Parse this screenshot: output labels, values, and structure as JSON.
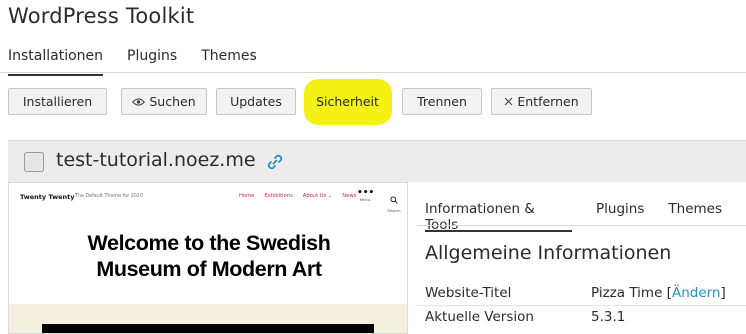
{
  "app": {
    "title": "WordPress Toolkit"
  },
  "main_tabs": [
    {
      "label": "Installationen",
      "active": true
    },
    {
      "label": "Plugins",
      "active": false
    },
    {
      "label": "Themes",
      "active": false
    }
  ],
  "toolbar": {
    "install_label": "Installieren",
    "search_label": "Suchen",
    "search_icon": "eye-icon",
    "updates_label": "Updates",
    "security_label": "Sicherheit",
    "detach_label": "Trennen",
    "remove_label": "Entfernen",
    "remove_icon": "close-icon",
    "highlight_color": "#f4f000"
  },
  "site": {
    "name": "test-tutorial.noez.me",
    "link_icon": "link-icon"
  },
  "preview": {
    "brand": "Twenty Twenty",
    "description": "The Default Theme for 2020",
    "nav": [
      "Home",
      "Exhibitions",
      "About Us ⌄",
      "News"
    ],
    "menu_label": "Menu",
    "search_label": "Search",
    "heading_line1": "Welcome to the Swedish",
    "heading_line2": "Museum of Modern Art",
    "accent_color": "#cd2653"
  },
  "detail_tabs": [
    {
      "label": "Informationen & Tools",
      "active": true
    },
    {
      "label": "Plugins",
      "active": false
    },
    {
      "label": "Themes",
      "active": false
    }
  ],
  "info": {
    "section_title": "Allgemeine Informationen",
    "rows": [
      {
        "label": "Website-Titel",
        "value": "Pizza Time",
        "link_prefix": "[",
        "link": "Ändern",
        "link_suffix": "]"
      },
      {
        "label": "Aktuelle Version",
        "value": "5.3.1"
      }
    ],
    "link_color": "#2a8fc6"
  }
}
